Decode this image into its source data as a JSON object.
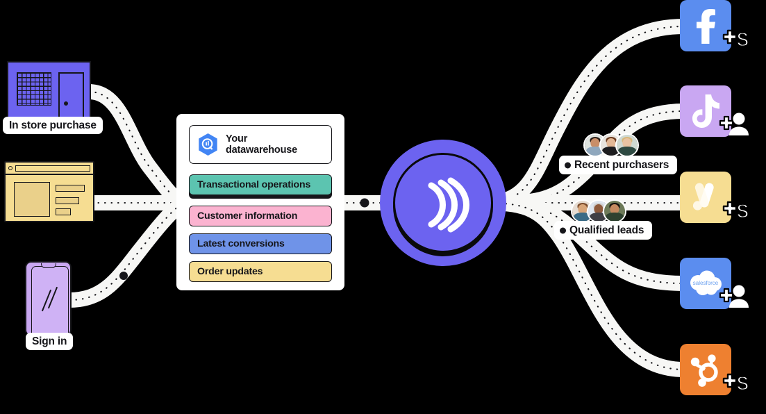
{
  "diagram": {
    "title": "Customer data activation flow",
    "background_color": "#000000"
  },
  "sources": [
    {
      "id": "in-store",
      "label": "In store purchase",
      "icon": "storefront-icon",
      "color": "#6c63f0"
    },
    {
      "id": "website",
      "label": "",
      "icon": "browser-window-icon",
      "color": "#f6dd92"
    },
    {
      "id": "sign-in",
      "label": "Sign in",
      "icon": "smartphone-icon",
      "color": "#c9a7f2"
    }
  ],
  "warehouse": {
    "icon": "bigquery-hexagon-icon",
    "title_line1": "Your",
    "title_line2": "datawarehouse",
    "rows": [
      {
        "label": "Transactional operations",
        "color": "#5cc4b0",
        "raised": true
      },
      {
        "label": "Customer information",
        "color": "#fbb3d0",
        "raised": false
      },
      {
        "label": "Latest conversions",
        "color": "#6f93e8",
        "raised": false
      },
      {
        "label": "Order updates",
        "color": "#f6dd92",
        "raised": false
      }
    ]
  },
  "hub": {
    "name": "waves-logo",
    "color": "#6c63f0",
    "logo_color": "#ffffff"
  },
  "audiences": [
    {
      "id": "recent-purchasers",
      "label": "Recent purchasers",
      "avatar_count": 3,
      "avatars": [
        {
          "skin": "#c98e68",
          "hair": "#2b1d16",
          "shirt": "#8fa7bd",
          "bg": "#dfe4e0"
        },
        {
          "skin": "#e3b896",
          "hair": "#6b3a1e",
          "shirt": "#1d1d1f",
          "bg": "#e8e4de"
        },
        {
          "skin": "#e8c3a3",
          "hair": "#d8b77a",
          "shirt": "#2e4a42",
          "bg": "#cfd9d2"
        }
      ]
    },
    {
      "id": "qualified-leads",
      "label": "Qualified leads",
      "avatar_count": 3,
      "avatars": [
        {
          "skin": "#d8a579",
          "hair": "#7a4a2a",
          "shirt": "#3a6b86",
          "bg": "#e6dcd2"
        },
        {
          "skin": "#8e5a3c",
          "hair": "#cfcfcf",
          "shirt": "#3f3f45",
          "bg": "#dfe6ef"
        },
        {
          "skin": "#c58a60",
          "hair": "#15110e",
          "shirt": "#2f4230",
          "bg": "#6d7a58"
        }
      ]
    }
  ],
  "destinations": [
    {
      "id": "facebook",
      "name": "facebook-icon",
      "color": "#5b8def",
      "badge": "plus-dollar-badge"
    },
    {
      "id": "tiktok",
      "name": "tiktok-icon",
      "color": "#c9a7f2",
      "badge": "add-person-badge"
    },
    {
      "id": "google-ads",
      "name": "google-ads-icon",
      "color": "#f6dd92",
      "badge": "plus-dollar-badge"
    },
    {
      "id": "salesforce",
      "name": "salesforce-icon",
      "color": "#5b8def",
      "badge": "add-person-badge"
    },
    {
      "id": "hubspot",
      "name": "hubspot-icon",
      "color": "#ee8030",
      "badge": "plus-dollar-badge"
    }
  ],
  "flows": {
    "pipe_color": "#f7f7f5",
    "dash_color": "#16161a",
    "marker_color": "#16161a",
    "marker_count": 4
  }
}
